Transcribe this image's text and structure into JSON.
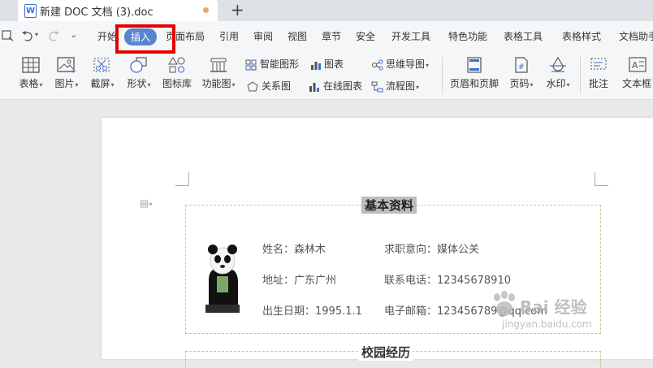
{
  "tabs": {
    "doc_title": "新建 DOC 文档 (3).doc",
    "doc_icon": "W",
    "new_tab": "+"
  },
  "menu": {
    "items": [
      "开始",
      "插入",
      "页面布局",
      "引用",
      "审阅",
      "视图",
      "章节",
      "安全",
      "开发工具",
      "特色功能",
      "表格工具",
      "表格样式",
      "文档助手"
    ],
    "active": "插入"
  },
  "toolbar": {
    "table": "表格",
    "picture": "图片",
    "screenshot": "截屏",
    "shape": "形状",
    "icon_lib": "图标库",
    "func_chart": "功能图",
    "smart_graphic": "智能图形",
    "chart": "图表",
    "mindmap": "思维导图",
    "relation": "关系图",
    "online_chart": "在线图表",
    "flowchart": "流程图",
    "header_footer": "页眉和页脚",
    "page_number": "页码",
    "watermark": "水印",
    "comment": "批注",
    "textbox": "文本框"
  },
  "document": {
    "section1_title": "基本资料",
    "section2_title": "校园经历",
    "fields": {
      "name": "姓名：森林木",
      "job": "求职意向：媒体公关",
      "address": "地址：广东广州",
      "phone": "联系电话：12345678910",
      "birth": "出生日期：1995.1.1",
      "email": "电子邮箱：123456789@qq.com"
    }
  },
  "watermark": {
    "text": "Bai 经验",
    "url": "jingyan.baidu.com"
  },
  "colors": {
    "accent": "#5b84cf",
    "highlight_box": "#e60000",
    "section_border": "#b8d08b"
  }
}
